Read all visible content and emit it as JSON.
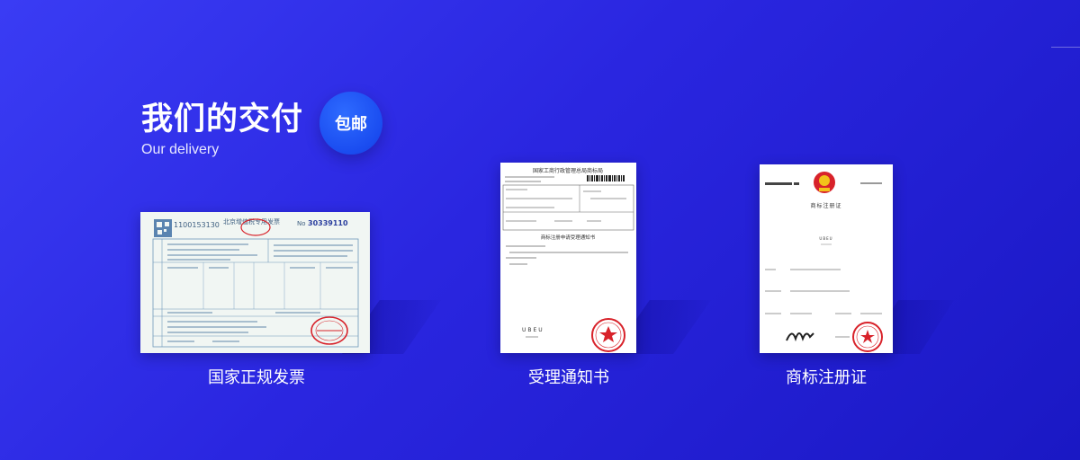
{
  "header": {
    "title": "我们的交付",
    "subtitle": "Our delivery",
    "badge": "包邮"
  },
  "deliverables": [
    {
      "caption": "国家正规发票",
      "doc": {
        "invoice_number_left": "1100153130",
        "invoice_title": "北京增值税专用发票",
        "invoice_no_label": "No",
        "invoice_number_right": "30339110"
      }
    },
    {
      "caption": "受理通知书",
      "doc": {
        "office_title": "国家工商行政管理总局商标局",
        "notice_title": "商标注册申请受理通知书",
        "brand": "UBEU"
      }
    },
    {
      "caption": "商标注册证",
      "doc": {
        "cert_title": "商标注册证",
        "brand": "UBEU"
      }
    }
  ],
  "colors": {
    "bg_start": "#3a3cf4",
    "bg_end": "#1a18c4",
    "badge": "#1a4cf0",
    "stamp_red": "#d8222a",
    "invoice_blue": "#4a7fa8"
  }
}
